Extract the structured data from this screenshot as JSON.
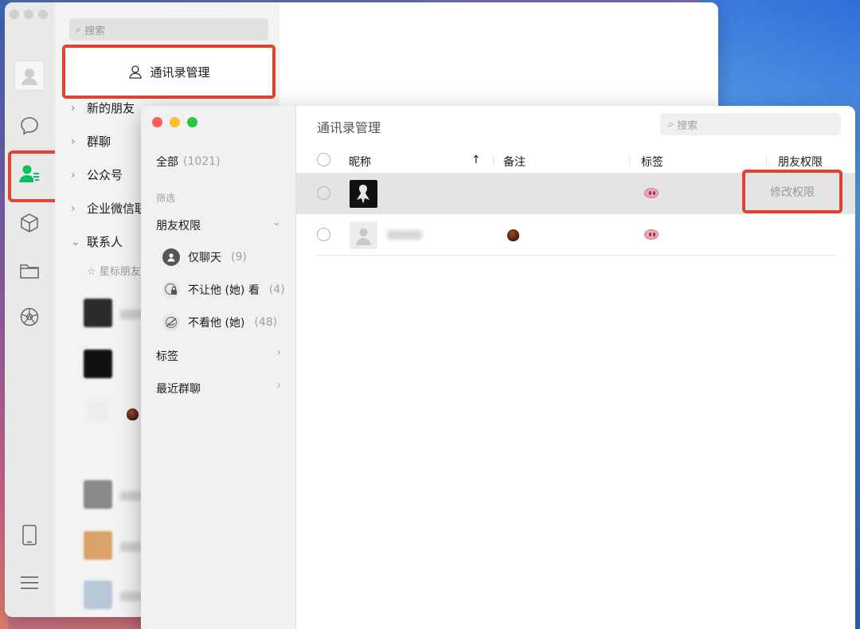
{
  "back_window": {
    "search_placeholder": "搜索",
    "manage_button": "通讯录管理",
    "groups": [
      {
        "label": "新的朋友",
        "expanded": false
      },
      {
        "label": "群聊",
        "expanded": false
      },
      {
        "label": "公众号",
        "expanded": false
      },
      {
        "label": "企业微信联",
        "expanded": false
      },
      {
        "label": "联系人",
        "expanded": true
      }
    ],
    "starred_label": "☆ 星标朋友"
  },
  "manager": {
    "title": "通讯录管理",
    "search_placeholder": "搜索",
    "sidebar": {
      "all_label": "全部",
      "all_count": "(1021)",
      "filter_label": "筛选",
      "perm_label": "朋友权限",
      "perm_items": [
        {
          "label": "仅聊天",
          "count": "(9)"
        },
        {
          "label": "不让他 (她) 看",
          "count": "(4)"
        },
        {
          "label": "不看他 (她)",
          "count": "(48)"
        }
      ],
      "tags_label": "标签",
      "recent_groups_label": "最近群聊"
    },
    "table": {
      "headers": {
        "nickname": "昵称",
        "sort": "↑",
        "remark": "备注",
        "tags": "标签",
        "permissions": "朋友权限"
      },
      "row_action": "修改权限"
    }
  },
  "colors": {
    "highlight": "#e0442f",
    "wechat_green": "#07c160",
    "selected_row": "#e4e4e4"
  }
}
